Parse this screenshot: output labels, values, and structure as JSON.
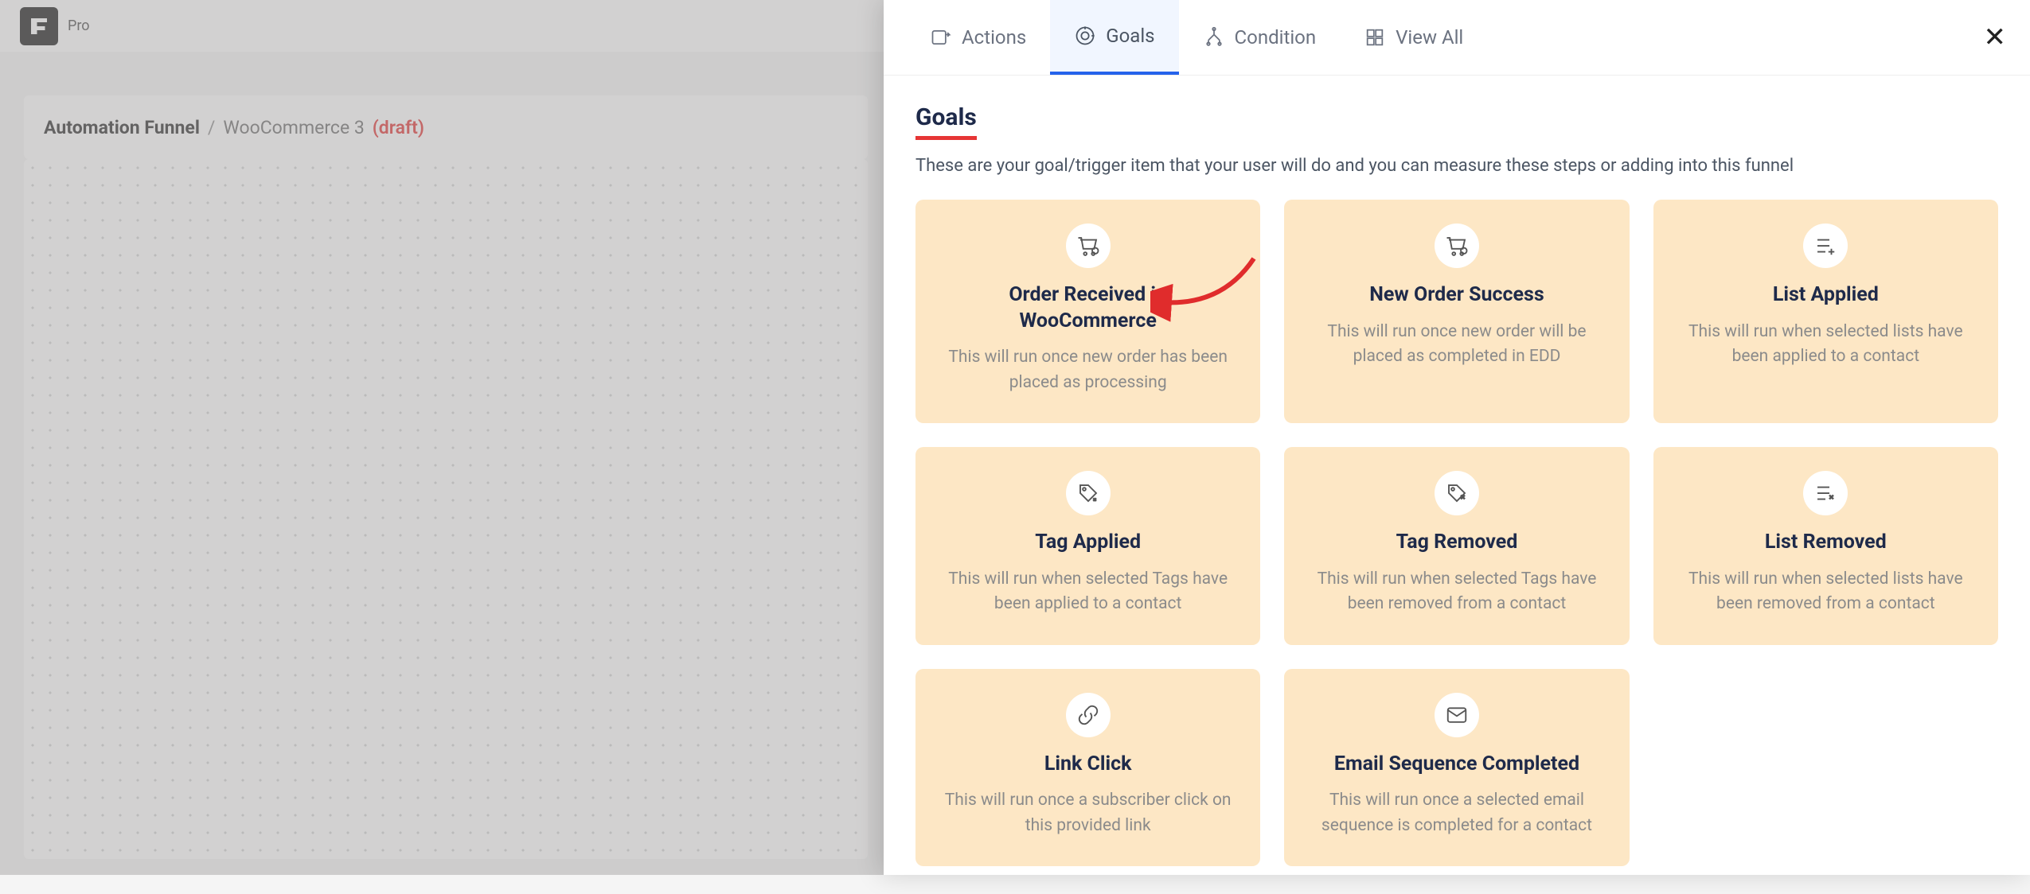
{
  "header": {
    "pro": "Pro"
  },
  "breadcrumb": {
    "main": "Automation Funnel",
    "sep": "/",
    "sub": "WooCommerce 3",
    "status": "(draft)"
  },
  "panel": {
    "close_label": "✕",
    "tabs": [
      {
        "label": "Actions",
        "icon": "action"
      },
      {
        "label": "Goals",
        "icon": "goal"
      },
      {
        "label": "Condition",
        "icon": "condition"
      },
      {
        "label": "View All",
        "icon": "grid"
      }
    ],
    "title": "Goals",
    "description": "These are your goal/trigger item that your user will do and you can measure these steps or adding into this funnel",
    "cards": [
      {
        "title": "Order Received in WooCommerce",
        "desc": "This will run once new order has been placed as processing",
        "icon": "cart"
      },
      {
        "title": "New Order Success",
        "desc": "This will run once new order will be placed as completed in EDD",
        "icon": "cart"
      },
      {
        "title": "List Applied",
        "desc": "This will run when selected lists have been applied to a contact",
        "icon": "list-add"
      },
      {
        "title": "Tag Applied",
        "desc": "This will run when selected Tags have been applied to a contact",
        "icon": "tag-add"
      },
      {
        "title": "Tag Removed",
        "desc": "This will run when selected Tags have been removed from a contact",
        "icon": "tag-remove"
      },
      {
        "title": "List Removed",
        "desc": "This will run when selected lists have been removed from a contact",
        "icon": "list-remove"
      },
      {
        "title": "Link Click",
        "desc": "This will run once a subscriber click on this provided link",
        "icon": "link"
      },
      {
        "title": "Email Sequence Completed",
        "desc": "This will run once a selected email sequence is completed for a contact",
        "icon": "email"
      }
    ]
  }
}
